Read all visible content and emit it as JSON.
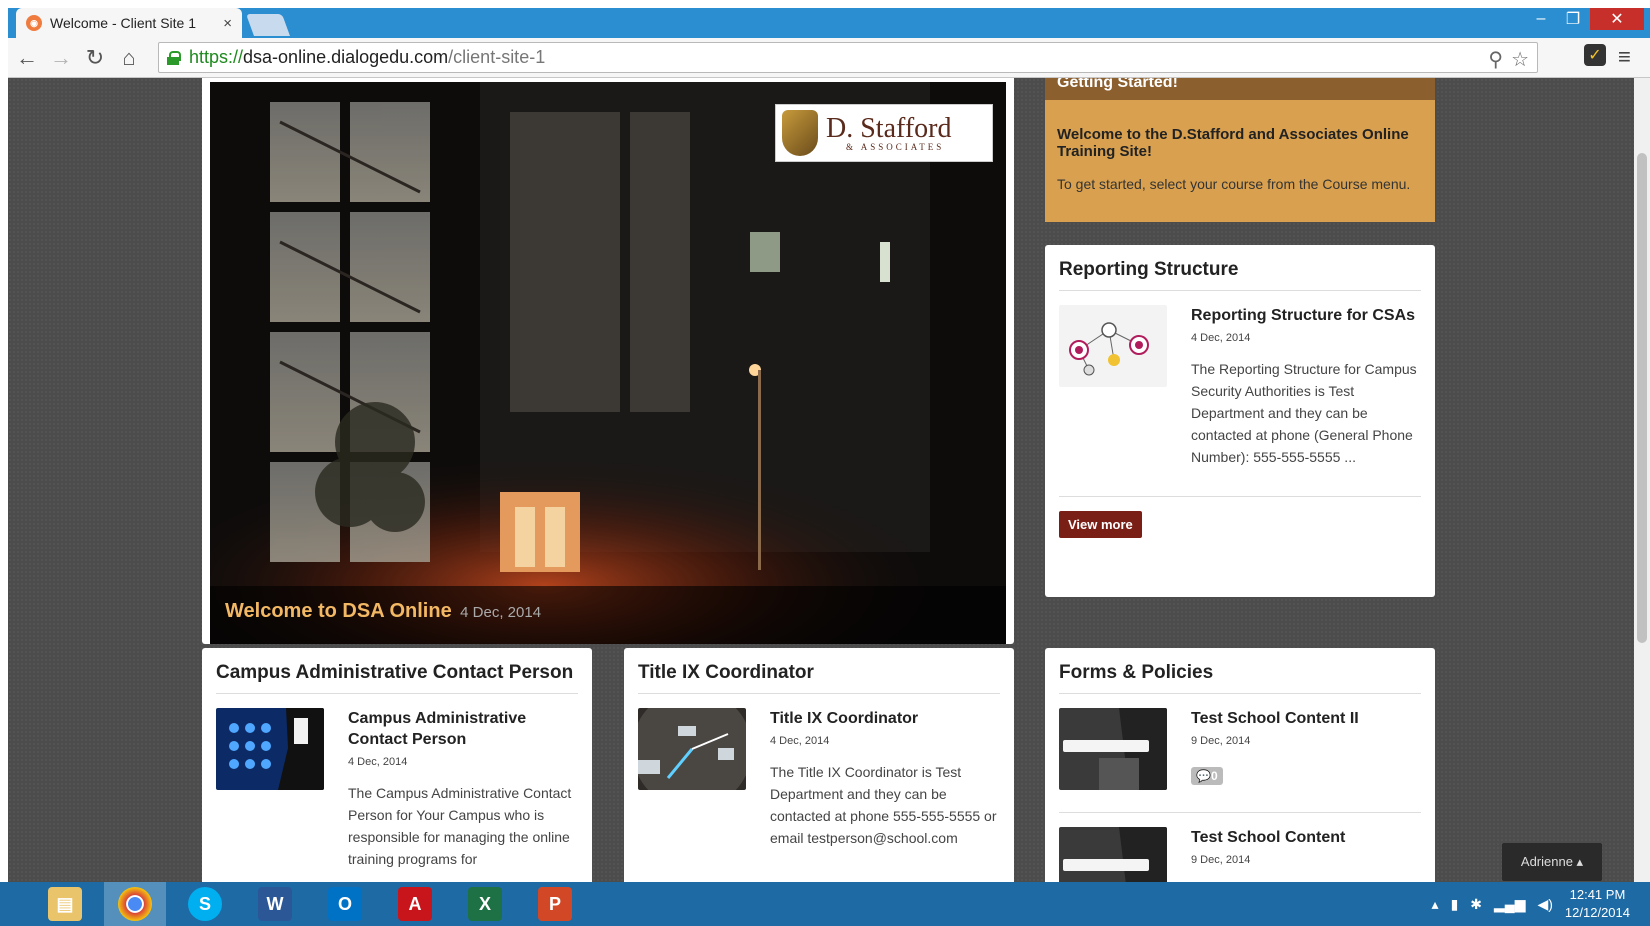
{
  "browser": {
    "tab_title": "Welcome - Client Site 1",
    "tab_close": "×",
    "url_scheme": "https://",
    "url_host": "dsa-online.dialogedu.com",
    "url_path": "/client-site-1",
    "win_min": "–",
    "win_max": "❐",
    "win_close": "✕"
  },
  "hero": {
    "logo_main": "D. Stafford",
    "logo_sub": "& ASSOCIATES",
    "caption_title": "Welcome to DSA Online",
    "caption_date": "4 Dec, 2014"
  },
  "getting_started": {
    "header": "Getting Started!",
    "title": "Welcome to the D.Stafford and Associates Online Training Site!",
    "text": "To get started, select your course from the Course menu."
  },
  "reporting": {
    "heading": "Reporting Structure",
    "article_title": "Reporting Structure for CSAs",
    "article_date": "4 Dec, 2014",
    "article_text": "The Reporting Structure for Campus Security Authorities is Test Department and they can be contacted at phone (General Phone Number): 555-555-5555 ...",
    "button": "View more"
  },
  "campus_admin": {
    "heading": "Campus Administrative Contact Person",
    "article_title": "Campus Administrative Contact Person",
    "article_date": "4 Dec, 2014",
    "article_text": "The Campus Administrative Contact Person for Your Campus who is responsible for managing the online training programs for"
  },
  "title_ix": {
    "heading": "Title IX Coordinator",
    "article_title": "Title IX Coordinator",
    "article_date": "4 Dec, 2014",
    "article_text": "The Title IX Coordinator is Test Department and they can be contacted at phone 555-555-5555 or email testperson@school.com"
  },
  "forms": {
    "heading": "Forms & Policies",
    "item1_title": "Test School Content II",
    "item1_date": "9 Dec, 2014",
    "item1_comments": "0",
    "item2_title": "Test School Content",
    "item2_date": "9 Dec, 2014"
  },
  "user_menu": "Adrienne ▴",
  "taskbar": {
    "time": "12:41 PM",
    "date": "12/12/2014"
  },
  "colors": {
    "accent_orange": "#d9a14f",
    "button_red": "#7a1f16",
    "caption_gold": "#f3b864",
    "taskbar_blue": "#1d6aa5"
  }
}
